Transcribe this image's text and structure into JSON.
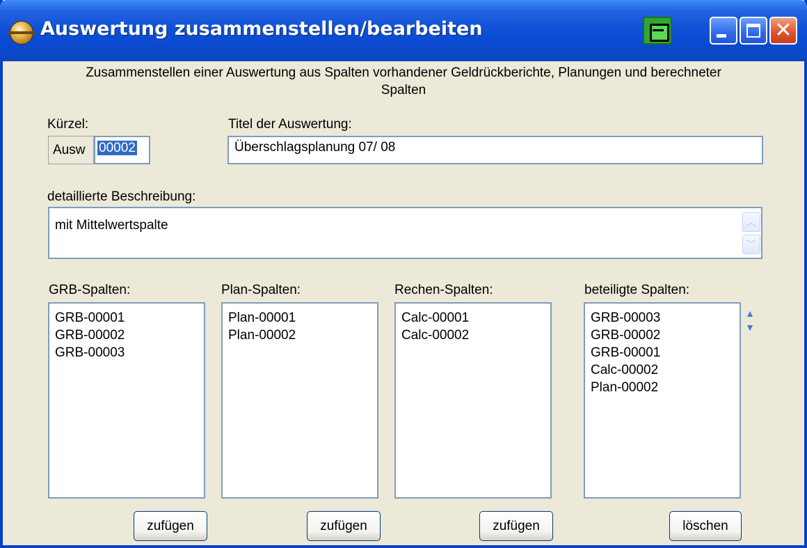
{
  "window": {
    "title": "Auswertung zusammenstellen/bearbeiten",
    "close_glyph": "✕"
  },
  "intro": "Zusammenstellen einer Auswertung aus Spalten vorhandener Geldrückberichte, Planungen und berechneter Spalten",
  "kuerzel": {
    "label": "Kürzel:",
    "prefix": "Ausw",
    "value": "00002"
  },
  "titel": {
    "label": "Titel der Auswertung:",
    "value": "Überschlagsplanung 07/ 08"
  },
  "beschreibung": {
    "label": "detaillierte Beschreibung:",
    "value": "mit Mittelwertspalte"
  },
  "lists": {
    "grb": {
      "label": "GRB-Spalten:",
      "items": [
        "GRB-00001",
        "GRB-00002",
        "GRB-00003"
      ],
      "button": "zufügen"
    },
    "plan": {
      "label": "Plan-Spalten:",
      "items": [
        "Plan-00001",
        "Plan-00002"
      ],
      "button": "zufügen"
    },
    "rechen": {
      "label": "Rechen-Spalten:",
      "items": [
        "Calc-00001",
        "Calc-00002"
      ],
      "button": "zufügen"
    },
    "beteiligt": {
      "label": "beteiligte Spalten:",
      "items": [
        "GRB-00003",
        "GRB-00002",
        "GRB-00001",
        "Calc-00002",
        "Plan-00002"
      ],
      "button": "löschen"
    }
  },
  "icons": {
    "app": "globe-icon",
    "print": "printer-icon",
    "minimize": "minimize-icon",
    "maximize": "maximize-icon",
    "close": "close-icon",
    "scroll_up": "chevron-up-icon",
    "scroll_down": "chevron-down-icon"
  },
  "colors": {
    "titlebar": "#0a4ad0",
    "window_bg": "#ece9d8",
    "selection": "#316ac5",
    "close_button": "#e05530",
    "print_button": "#2ea82e"
  }
}
